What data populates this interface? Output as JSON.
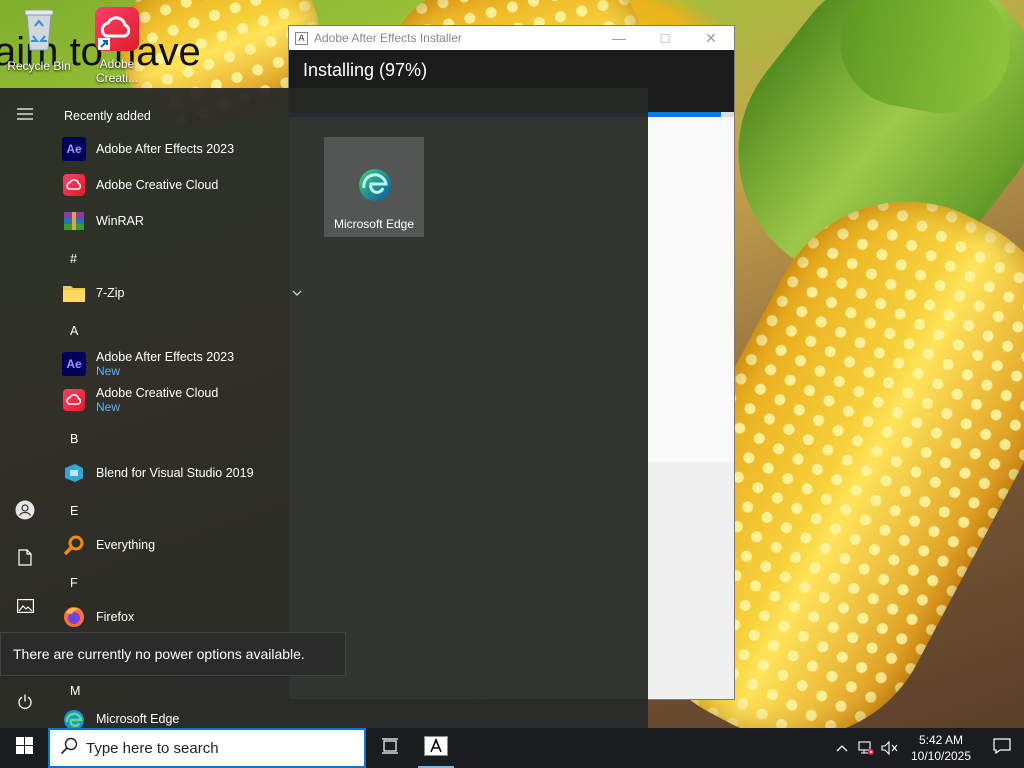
{
  "desktop": {
    "icons": [
      {
        "label": "Recycle Bin"
      },
      {
        "label": "Adobe Creati..."
      }
    ],
    "background_overlay_text": "aim to have"
  },
  "installer": {
    "title": "Adobe After Effects Installer",
    "status": "Installing (97%)",
    "progress_percent": 97,
    "accent": "#1473e6"
  },
  "start_menu": {
    "recently_added_label": "Recently added",
    "recent": [
      {
        "label": "Adobe After Effects 2023",
        "icon": "after-effects-icon"
      },
      {
        "label": "Adobe Creative Cloud",
        "icon": "creative-cloud-icon"
      },
      {
        "label": "WinRAR",
        "icon": "winrar-icon"
      }
    ],
    "sections": {
      "hash": "#",
      "a": "A",
      "b": "B",
      "e": "E",
      "f": "F",
      "m": "M"
    },
    "apps": {
      "seven_zip": "7-Zip",
      "after_effects": "Adobe After Effects 2023",
      "after_effects_badge": "New",
      "creative_cloud": "Adobe Creative Cloud",
      "creative_cloud_badge": "New",
      "blend": "Blend for Visual Studio 2019",
      "everything": "Everything",
      "firefox": "Firefox",
      "edge": "Microsoft Edge"
    },
    "tiles": [
      {
        "label": "Microsoft Edge",
        "icon": "edge-icon"
      }
    ]
  },
  "tooltip": {
    "text": "There are currently no power options available."
  },
  "taskbar": {
    "search_placeholder": "Type here to search",
    "time": "5:42 AM",
    "date": "10/10/2025"
  },
  "colors": {
    "start_bg": "#262826",
    "taskbar_bg": "#1a1d20",
    "new_badge": "#5fb4f5",
    "search_border": "#0078d7"
  }
}
